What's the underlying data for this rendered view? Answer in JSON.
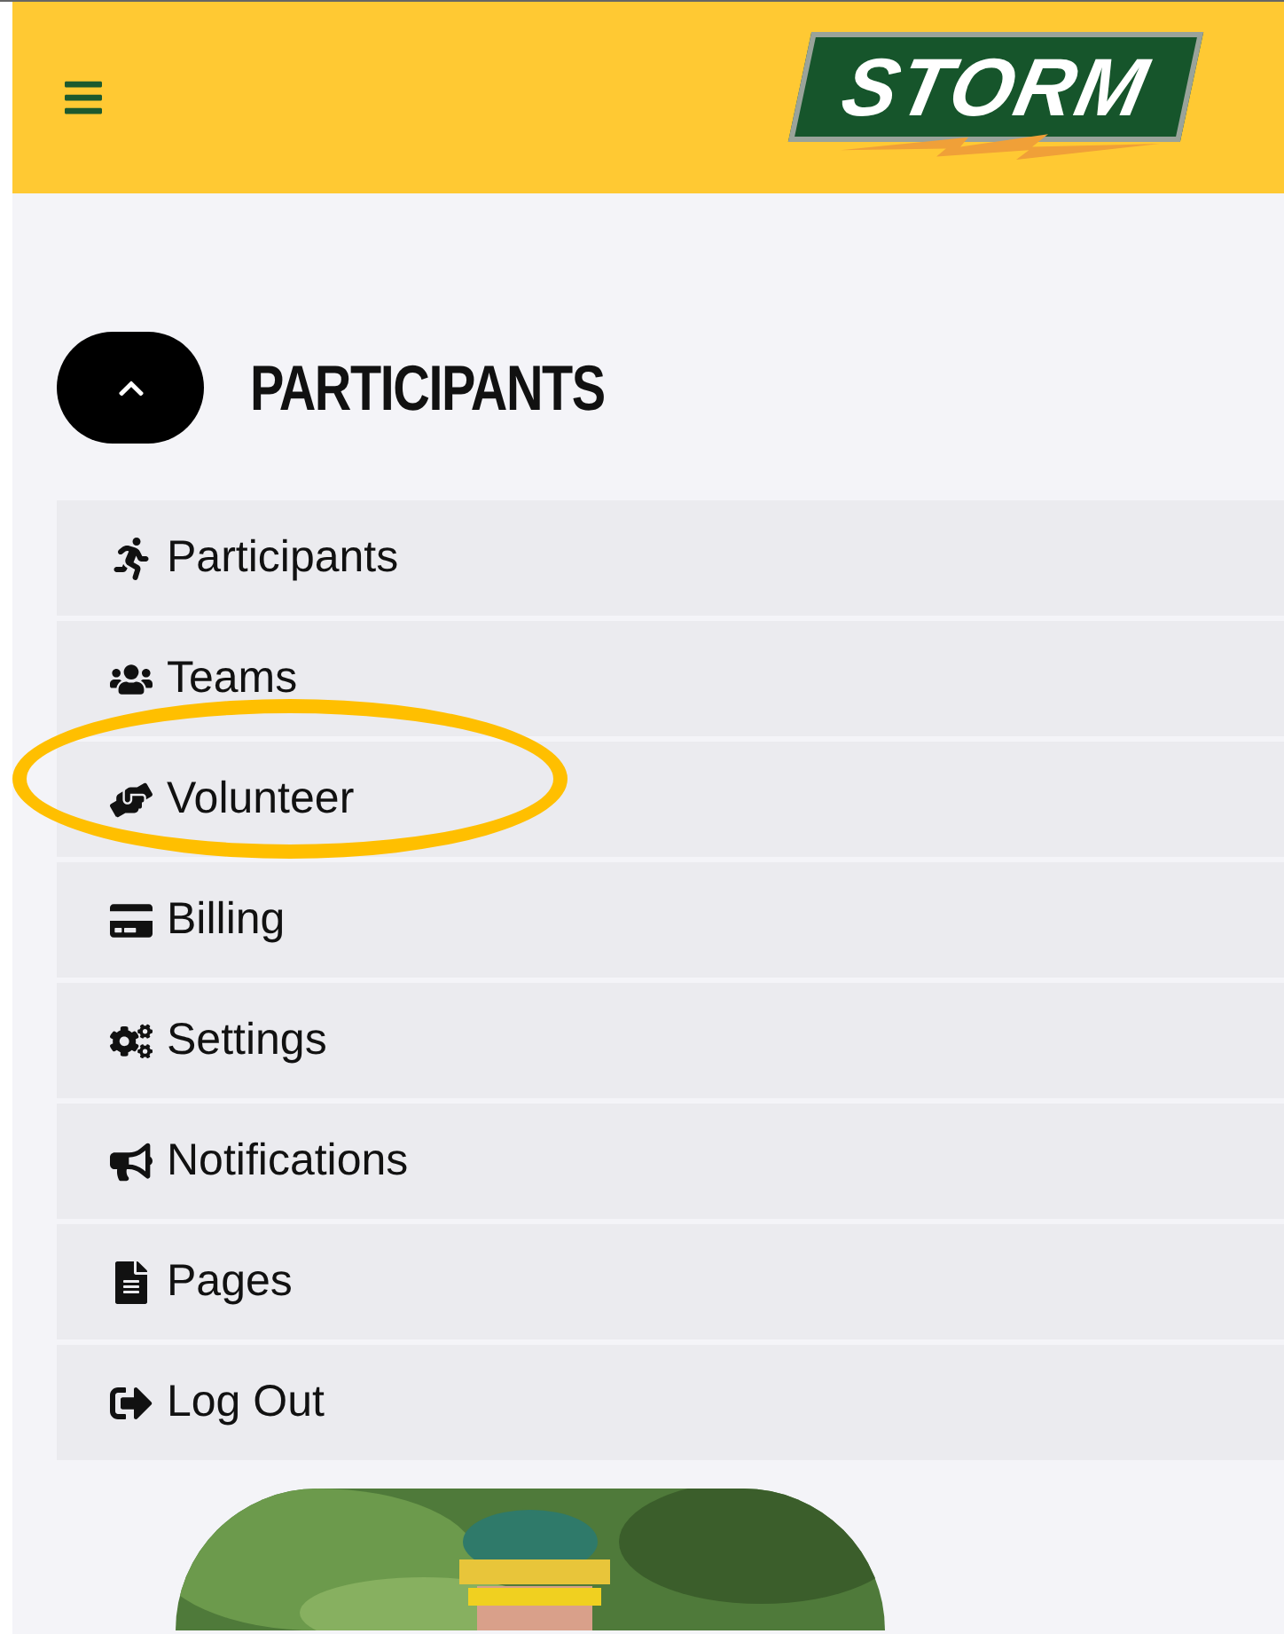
{
  "header": {
    "logo_text": "STORM"
  },
  "section": {
    "title": "PARTICIPANTS",
    "expanded": true
  },
  "menu": [
    {
      "label": "Participants"
    },
    {
      "label": "Teams"
    },
    {
      "label": "Volunteer"
    },
    {
      "label": "Billing"
    },
    {
      "label": "Settings"
    },
    {
      "label": "Notifications"
    },
    {
      "label": "Pages"
    },
    {
      "label": "Log Out"
    }
  ]
}
